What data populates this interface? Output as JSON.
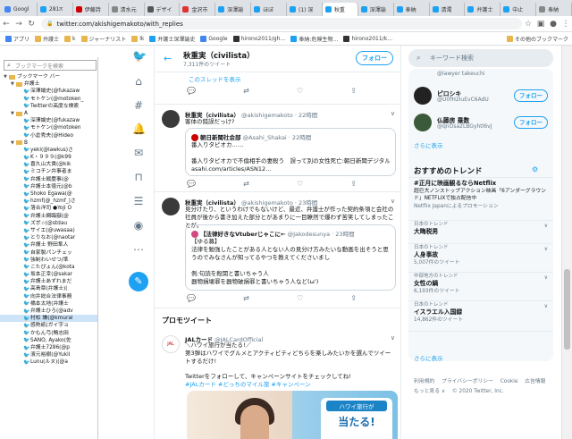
{
  "browser": {
    "tabs": [
      {
        "label": "Googl",
        "color": "#4285f4"
      },
      {
        "label": "281ਨ",
        "color": "#1da1f2"
      },
      {
        "label": "伊藤詩",
        "color": "#c00"
      },
      {
        "label": "清水元",
        "color": "#888"
      },
      {
        "label": "デザイ",
        "color": "#555"
      },
      {
        "label": "金沢市",
        "color": "#d33"
      },
      {
        "label": "深澤諭",
        "color": "#1da1f2"
      },
      {
        "label": "ほぼ",
        "color": "#1da1f2"
      },
      {
        "label": "(1) 深",
        "color": "#1da1f2"
      },
      {
        "label": "秋重",
        "color": "#1da1f2",
        "active": true
      },
      {
        "label": "深澤諭",
        "color": "#1da1f2"
      },
      {
        "label": "奉納",
        "color": "#1da1f2"
      },
      {
        "label": "清濁",
        "color": "#1da1f2"
      },
      {
        "label": "弁護士",
        "color": "#1da1f2"
      },
      {
        "label": "中止",
        "color": "#1da1f2"
      },
      {
        "label": "奉納",
        "color": "#888"
      }
    ],
    "url": "twitter.com/akishigemakoto/with_replies",
    "bookmarks_bar": [
      {
        "label": "アプリ",
        "color": "#4285f4"
      },
      {
        "label": "弁護士",
        "color": "#e8b64c"
      },
      {
        "label": "k",
        "color": "#e8b64c"
      },
      {
        "label": "ジャーナリスト",
        "color": "#e8b64c"
      },
      {
        "label": "lk",
        "color": "#e8b64c"
      },
      {
        "label": "弁護士深澤諭史",
        "color": "#1da1f2"
      },
      {
        "label": "Google",
        "color": "#4285f4"
      },
      {
        "label": "hirono2011/gh…",
        "color": "#333"
      },
      {
        "label": "奉納:危険生物…",
        "color": "#1da1f2"
      },
      {
        "label": "hirono2011/k…",
        "color": "#333"
      }
    ],
    "other_bookmarks": "その他のブックマーク"
  },
  "bookmark_panel": {
    "search_placeholder": "ブックマークを検索",
    "rows": [
      {
        "label": "ブックマーク バー",
        "type": "folder",
        "indent": 0,
        "tri": "▼"
      },
      {
        "label": "弁護士",
        "type": "folder",
        "indent": 1,
        "tri": "▼"
      },
      {
        "label": "深澤諭史(@fukazaw",
        "type": "tw",
        "indent": 2
      },
      {
        "label": "モトケン(@motoken_",
        "type": "tw",
        "indent": 2
      },
      {
        "label": "Twitterの高度な検索",
        "type": "tw",
        "indent": 2
      },
      {
        "label": "A",
        "type": "folder",
        "indent": 1,
        "tri": "▼"
      },
      {
        "label": "深澤諭史(@fukazaw",
        "type": "tw",
        "indent": 2
      },
      {
        "label": "モトケン(@motoken",
        "type": "tw",
        "indent": 2
      },
      {
        "label": "小倉秀夫(@Hideo",
        "type": "tw",
        "indent": 2
      },
      {
        "label": "B",
        "type": "folder",
        "indent": 1,
        "tri": "▼"
      },
      {
        "label": "yeki(@lawkus)さ",
        "type": "tw",
        "indent": 2
      },
      {
        "label": "K・９９９(@k99",
        "type": "tw",
        "indent": 2
      },
      {
        "label": "喜久山大貴(@kik",
        "type": "tw",
        "indent": 2
      },
      {
        "label": "ミコチン弁事者ま",
        "type": "tw",
        "indent": 2
      },
      {
        "label": "弁護士戦慶事(@",
        "type": "tw",
        "indent": 2
      },
      {
        "label": "弁護士本徳元(@b",
        "type": "tw",
        "indent": 2
      },
      {
        "label": "Shoko Egawa(@",
        "type": "tw",
        "indent": 2
      },
      {
        "label": "hzmf(@_hzmf_)さ",
        "type": "tw",
        "indent": 2
      },
      {
        "label": "落合洋司 ●Yoji O",
        "type": "tw",
        "indent": 2
      },
      {
        "label": "弁護士網臨嶽(@",
        "type": "tw",
        "indent": 2
      },
      {
        "label": "ズボ☆(@stdau",
        "type": "tw",
        "indent": 2
      },
      {
        "label": "サイエ(@uwasaa)",
        "type": "tw",
        "indent": 2
      },
      {
        "label": "とりなお(@naotar",
        "type": "tw",
        "indent": 2
      },
      {
        "label": "弁護士 野田隼人",
        "type": "tw",
        "indent": 2
      },
      {
        "label": "自家製パンチェッ",
        "type": "tw",
        "indent": 2
      },
      {
        "label": "強制わいせつ/準",
        "type": "tw",
        "indent": 2
      },
      {
        "label": "こたぴょん(@kota",
        "type": "tw",
        "indent": 2
      },
      {
        "label": "坂本正幸(@sakar",
        "type": "tw",
        "indent": 2
      },
      {
        "label": "弁護士あずれまだ",
        "type": "tw",
        "indent": 2
      },
      {
        "label": "高島章(弁護士)(",
        "type": "tw",
        "indent": 2
      },
      {
        "label": "向井総合法律事務",
        "type": "tw",
        "indent": 2
      },
      {
        "label": "橋本太地(弁護士",
        "type": "tw",
        "indent": 2
      },
      {
        "label": "弁護士ひろ(@adv",
        "type": "tw",
        "indent": 2
      },
      {
        "label": "村松 謙(@kmurai",
        "type": "tw",
        "indent": 2,
        "selected": true
      },
      {
        "label": "感熱紙(ガイ字ョ",
        "type": "tw",
        "indent": 2
      },
      {
        "label": "かもん弓(鴨志田",
        "type": "tw",
        "indent": 2
      },
      {
        "label": "SANO, Ayako(佐",
        "type": "tw",
        "indent": 2
      },
      {
        "label": "弁護士7286(@p",
        "type": "tw",
        "indent": 2
      },
      {
        "label": "濱元裕樹(@Yukil",
        "type": "tw",
        "indent": 2
      },
      {
        "label": "Lunu(ルヌ)(@a",
        "type": "tw",
        "indent": 2
      }
    ]
  },
  "twitter_nav": {
    "icons": [
      "twitter-logo-icon",
      "home-icon",
      "hashtag-icon",
      "bell-icon",
      "envelope-icon",
      "bookmark-icon",
      "list-icon",
      "profile-icon",
      "more-icon"
    ]
  },
  "timeline": {
    "name": "秋重実（civilista）",
    "tweet_count": "7,311件のツイート",
    "follow": "フォロー",
    "thread_link": "このスレッドを表示",
    "tweet1": {
      "author": "秋重実（civilista）",
      "handle": "@akishigemakoto · 22時間",
      "text": "客体の錯誤だっけ?",
      "quote_author": "朝日新聞社会部",
      "quote_handle": "@Asahi_Shakai · 22時間",
      "quote_text": "番入りタピオカ……\n\n番入りタピオカで不倫相手の妻殺う　誤って別の女性死亡:朝日新聞デジタル asahi.com/articles/ASN12…"
    },
    "tweet2": {
      "author": "秋重実（civilista）",
      "handle": "@akishigemakoto · 23時間",
      "text": "見分けたり、というわけでもないけど、最近、弁護士が作った契約条項と会社の社員が後から書き加えた部分とがあまりに一目瞭然で爆わず苦笑してしまったことが。",
      "quote_author": "【法律好きなVtuberじゃこに←",
      "quote_handle": "@Jakodesunya · 23時間",
      "quote_text": "【ゆる募】\n法律を勉強したことがある人とない人の見分け方みたいな動画を出そうと思うのでみなさんが知ってるやつを教えてくださいまし\n\n例:句読を殺関と書いちゃう人\n器物損壊罪を器物破損罪と書いちゃう人など(ω')"
    },
    "promo_title": "プロモツイート",
    "promo": {
      "author": "JALカード",
      "handle": "@JALCardOfficial",
      "text1": "＼ハワイ旅行が当たる!／",
      "text2": "第3弾はハワイでグルメとアクティビティどちらを楽しみたいかを選んでツイートするだけ!",
      "text3": "Twitterをフォローして、キャンペーンサイトをチェックしてね!",
      "tags": "#JALカード #どっちのマイル旅 #キャンペーン",
      "badge1": "ハワイ旅行が",
      "badge2": "当たる!"
    }
  },
  "right": {
    "search_placeholder": "キーワード検索",
    "who": [
      {
        "name": "",
        "handle": "@lawyer takeuchi",
        "color": "#777"
      },
      {
        "name": "ピロシキ",
        "handle": "@U0fH2IuEvC6AdU",
        "color": "#222",
        "button": "フォロー"
      },
      {
        "name": "仏藤房 乗数",
        "handle": "@qnOsa2LBGyhtl6vJ",
        "color": "#3a5a3a",
        "button": "フォロー"
      }
    ],
    "who_more": "さらに表示",
    "trends_title": "おすすめのトレンド",
    "trends": [
      {
        "ctx": "",
        "name": "#正月に映画観るならNetflix",
        "cnt": "超巨大ノンストップアクション映画「6アンダーグラウンド」NETFLIXで独占配信中",
        "extra": "Netflix Japanによるプロモーション"
      },
      {
        "ctx": "日本のトレンド",
        "name": "大晦税男",
        "cnt": ""
      },
      {
        "ctx": "日本のトレンド",
        "name": "人身事故",
        "cnt": "5,007件のツイート"
      },
      {
        "ctx": "中部地方のトレンド",
        "name": "女性の鍋",
        "cnt": "6,193件のツイート"
      },
      {
        "ctx": "日本のトレンド",
        "name": "イスラエル入国録",
        "cnt": "14,862件のツイート"
      }
    ],
    "trends_more": "さらに表示",
    "footer": [
      "利用規約",
      "プライバシーポリシー",
      "Cookie",
      "広告情報",
      "もっと見る ∨",
      "© 2020 Twitter, Inc."
    ]
  }
}
